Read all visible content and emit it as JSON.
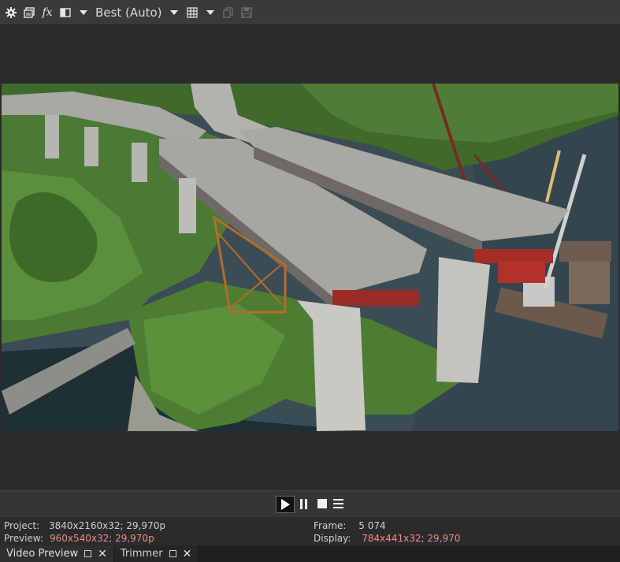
{
  "toolbar": {
    "icons": [
      "gear-icon",
      "copy-frame-icon",
      "fx-icon",
      "split-screen-icon",
      "chevron-down-icon",
      "grid-icon",
      "chevron-down-icon",
      "copy-snapshot-icon",
      "save-snapshot-icon"
    ],
    "fx_label": "fx",
    "quality": "Best (Auto)"
  },
  "preview": {
    "image_subject": "aerial view of bridge under construction over river"
  },
  "transport": {
    "icons": [
      "play-icon",
      "pause-icon",
      "stop-icon",
      "menu-icon"
    ]
  },
  "info": {
    "project_label": "Project:",
    "project_value": "3840x2160x32; 29,970p",
    "preview_label": "Preview:",
    "preview_value": "960x540x32; 29,970p",
    "frame_label": "Frame:",
    "frame_value": "5 074",
    "display_label": "Display:",
    "display_value": "784x441x32; 29,970",
    "highlight_color": "#f08a8a"
  },
  "tabs": [
    {
      "label": "Video Preview",
      "active": true
    },
    {
      "label": "Trimmer",
      "active": false
    }
  ]
}
